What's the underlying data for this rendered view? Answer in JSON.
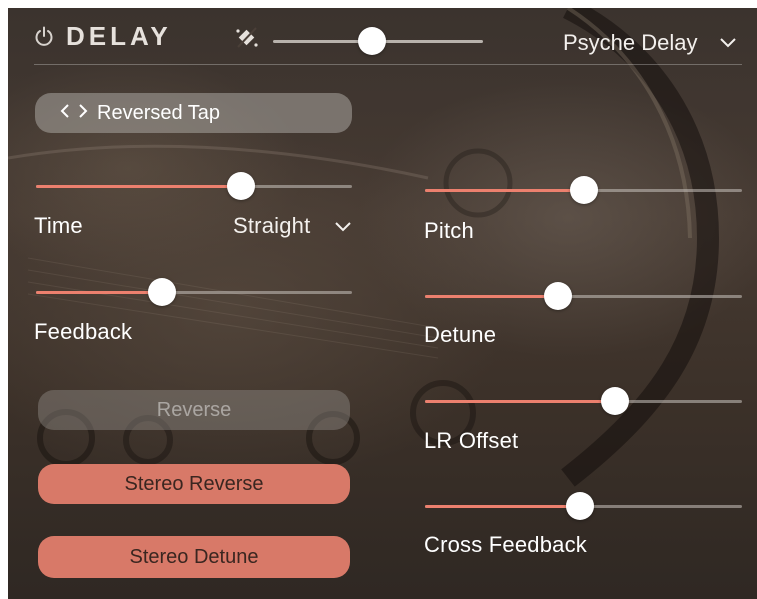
{
  "header": {
    "title": "DELAY",
    "preset_name": "Psyche Delay",
    "mix_value": 0.47
  },
  "mode_button": {
    "label": "Reversed Tap"
  },
  "sliders": {
    "time": {
      "label": "Time",
      "value": 0.65
    },
    "time_sync": {
      "label": "Straight"
    },
    "feedback": {
      "label": "Feedback",
      "value": 0.4
    },
    "pitch": {
      "label": "Pitch",
      "value": 0.5
    },
    "detune": {
      "label": "Detune",
      "value": 0.42
    },
    "lr_offset": {
      "label": "LR Offset",
      "value": 0.6
    },
    "cross_feedback": {
      "label": "Cross Feedback",
      "value": 0.49
    }
  },
  "buttons": {
    "reverse": {
      "label": "Reverse",
      "active": false
    },
    "stereo_reverse": {
      "label": "Stereo Reverse",
      "active": true
    },
    "stereo_detune": {
      "label": "Stereo Detune",
      "active": true
    }
  },
  "colors": {
    "accent": "#ec806e",
    "button_active": "#d87968",
    "text": "#ffffff"
  }
}
